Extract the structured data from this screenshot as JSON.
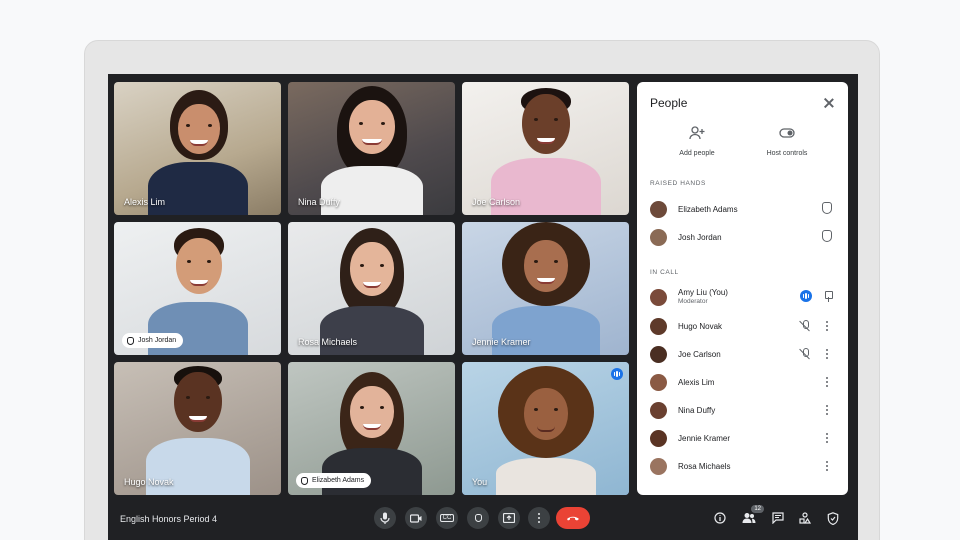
{
  "meeting": {
    "title": "English Honors Period 4"
  },
  "tiles": [
    {
      "name": "Alexis Lim",
      "hand": false
    },
    {
      "name": "Nina Duffy",
      "hand": false
    },
    {
      "name": "Joe Carlson",
      "hand": false
    },
    {
      "name": "Josh Jordan",
      "hand": true
    },
    {
      "name": "Rosa Michaels",
      "hand": false
    },
    {
      "name": "Jennie Kramer",
      "hand": false
    },
    {
      "name": "Hugo Novak",
      "hand": false
    },
    {
      "name": "Elizabeth Adams",
      "hand": true
    },
    {
      "name": "You",
      "hand": false,
      "speaking": true
    }
  ],
  "panel": {
    "title": "People",
    "actions": {
      "add_people": "Add people",
      "host_controls": "Host controls"
    },
    "raised_hands_label": "RAISED HANDS",
    "raised_hands": [
      {
        "name": "Elizabeth Adams"
      },
      {
        "name": "Josh Jordan"
      }
    ],
    "in_call_label": "IN CALL",
    "in_call": [
      {
        "name": "Amy Liu (You)",
        "role": "Moderator"
      },
      {
        "name": "Hugo Novak"
      },
      {
        "name": "Joe Carlson"
      },
      {
        "name": "Alexis Lim"
      },
      {
        "name": "Nina Duffy"
      },
      {
        "name": "Jennie Kramer"
      },
      {
        "name": "Rosa Michaels"
      }
    ]
  },
  "toolbar": {
    "captions_label": "CC",
    "participants_count": "12"
  },
  "colors": {
    "accent": "#1a73e8",
    "end_call": "#ea4335",
    "background": "#202124"
  }
}
